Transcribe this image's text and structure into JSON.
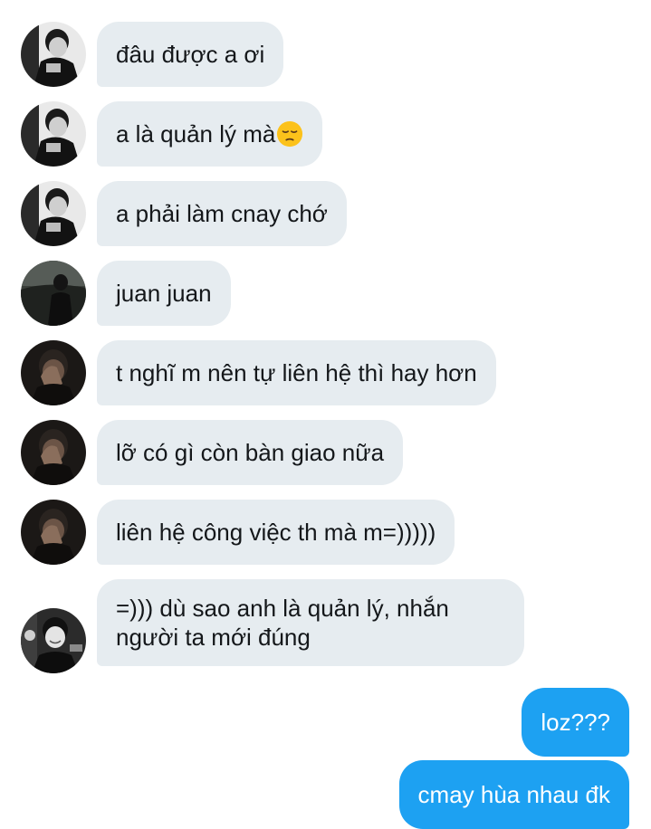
{
  "messages": [
    {
      "side": "in",
      "avatar": "avatar-bw-man",
      "text": "đâu được a ơi"
    },
    {
      "side": "in",
      "avatar": "avatar-bw-man",
      "text": "a là quản lý mà",
      "emoji": "pensive-face-icon"
    },
    {
      "side": "in",
      "avatar": "avatar-bw-man",
      "text": "a phải làm cnay chớ"
    },
    {
      "side": "in",
      "avatar": "avatar-dark-night",
      "text": "juan juan"
    },
    {
      "side": "in",
      "avatar": "avatar-hand-face",
      "text": "t nghĩ m nên tự liên hệ thì hay hơn"
    },
    {
      "side": "in",
      "avatar": "avatar-hand-face",
      "text": "lỡ có gì còn bàn giao nữa"
    },
    {
      "side": "in",
      "avatar": "avatar-hand-face",
      "text": "liên hệ công việc th mà m=)))))"
    },
    {
      "side": "in",
      "avatar": "avatar-smiling-man",
      "text": "=))) dù sao anh là quản lý, nhắn người ta mới đúng"
    },
    {
      "side": "out",
      "text": "loz???"
    },
    {
      "side": "out",
      "text": "cmay hùa nhau đk"
    }
  ],
  "colors": {
    "incoming_bubble": "#e6ecf0",
    "outgoing_bubble": "#1da1f2",
    "incoming_text": "#14171a",
    "outgoing_text": "#ffffff"
  }
}
